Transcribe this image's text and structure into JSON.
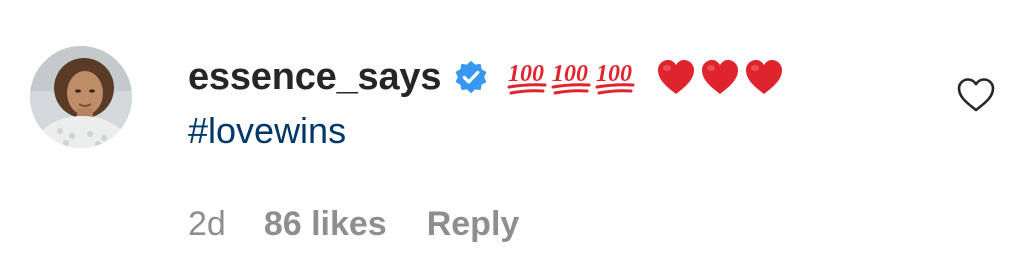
{
  "comment": {
    "username": "essence_says",
    "verified_icon": "verified-badge-icon",
    "emojis": [
      "💯",
      "💯",
      "💯",
      "❤️",
      "❤️",
      "❤️"
    ],
    "hashtag": "#lovewins",
    "time": "2d",
    "likes": "86 likes",
    "reply_label": "Reply",
    "like_icon": "heart-outline-icon"
  },
  "colors": {
    "username": "#262626",
    "hashtag": "#00376b",
    "meta": "#8e8e8e",
    "verified": "#3897f0",
    "heart": "#e0242e",
    "hundred": "#e0242e"
  }
}
